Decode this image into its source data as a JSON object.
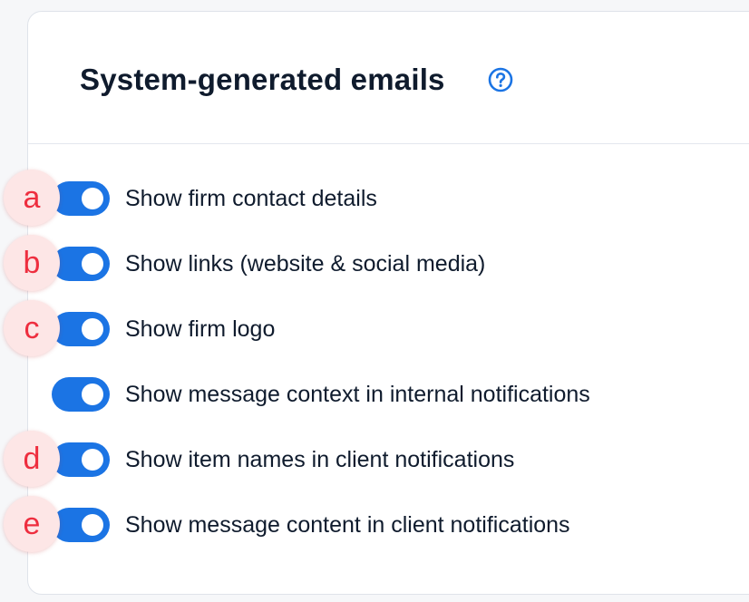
{
  "section": {
    "title": "System-generated emails",
    "help_icon": "question-circle-icon"
  },
  "toggles": [
    {
      "label": "Show firm contact details",
      "enabled": true
    },
    {
      "label": "Show links (website & social media)",
      "enabled": true
    },
    {
      "label": "Show firm logo",
      "enabled": true
    },
    {
      "label": "Show message context in internal notifications",
      "enabled": true
    },
    {
      "label": "Show item names in client notifications",
      "enabled": true
    },
    {
      "label": "Show message content in client notifications",
      "enabled": true
    }
  ],
  "markers": [
    "a",
    "b",
    "c",
    "d",
    "e"
  ],
  "colors": {
    "toggle_on": "#1b74e4",
    "help_icon": "#1b74e4",
    "marker_text": "#ee2e3f",
    "marker_bg": "#fde6e6"
  }
}
